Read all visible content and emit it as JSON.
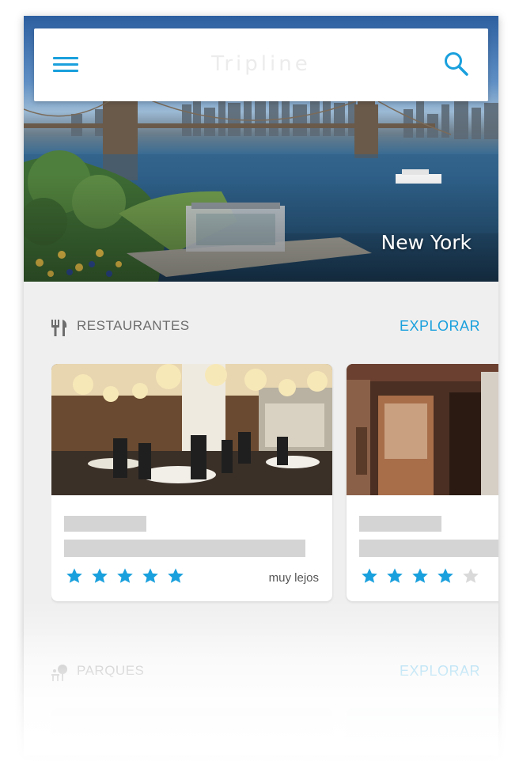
{
  "app": {
    "title": "Tripline"
  },
  "hero": {
    "city": "New York"
  },
  "sections": [
    {
      "title": "RESTAURANTES",
      "icon": "restaurant-icon",
      "explore_label": "EXPLORAR",
      "cards": [
        {
          "rating": 5,
          "max_rating": 5,
          "distance": "muy lejos"
        },
        {
          "rating": 4,
          "max_rating": 5,
          "distance": ""
        }
      ]
    },
    {
      "title": "PARQUES",
      "icon": "park-icon",
      "explore_label": "EXPLORAR"
    }
  ],
  "colors": {
    "accent": "#1aa0dd",
    "star_filled": "#1aa0dd",
    "star_empty": "#d9d9d9",
    "placeholder": "#d4d4d4",
    "background": "#efefef"
  }
}
